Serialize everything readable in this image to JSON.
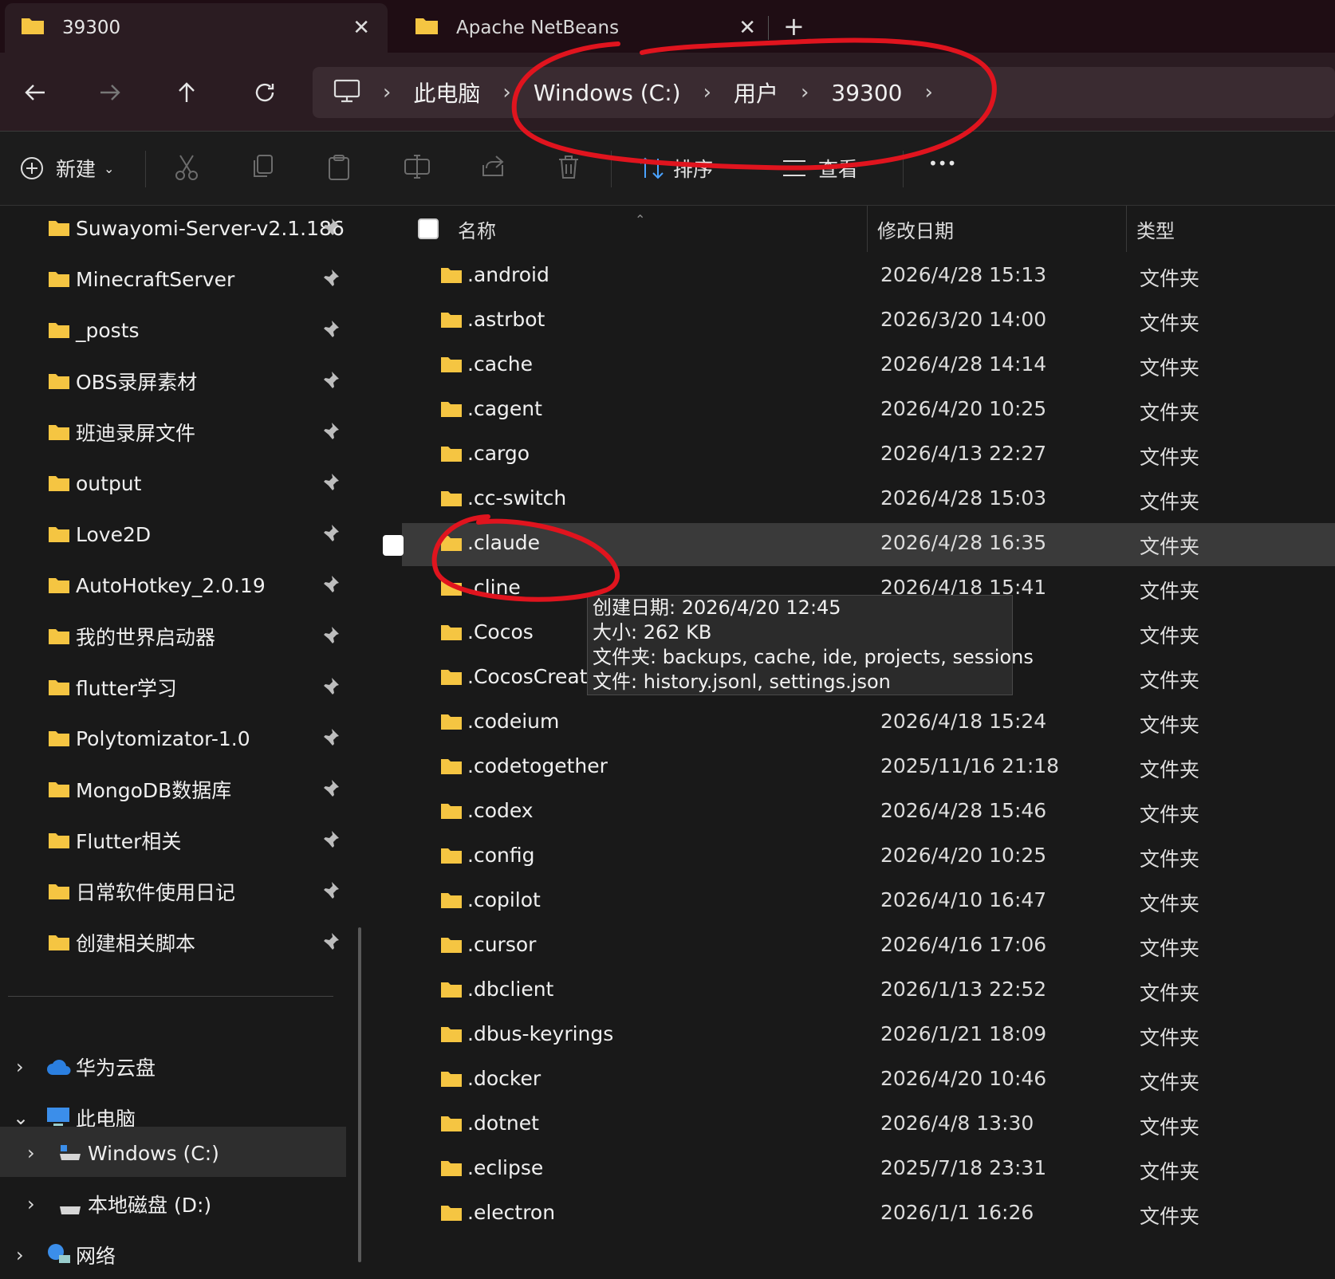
{
  "tabs": [
    {
      "label": "39300",
      "active": true
    },
    {
      "label": "Apache NetBeans",
      "active": false
    }
  ],
  "tab_close_glyph": "✕",
  "new_tab_glyph": "+",
  "breadcrumb": [
    "此电脑",
    "Windows (C:)",
    "用户",
    "39300"
  ],
  "toolbar": {
    "new_label": "新建",
    "sort_label": "排序",
    "view_label": "查看",
    "more_glyph": "•••"
  },
  "sidebar": {
    "pinned": [
      "Suwayomi-Server-v2.1.186",
      "MinecraftServer",
      "_posts",
      "OBS录屏素材",
      "班迪录屏文件",
      "output",
      "Love2D",
      "AutoHotkey_2.0.19",
      "我的世界启动器",
      "flutter学习",
      "Polytomizator-1.0",
      "MongoDB数据库",
      "Flutter相关",
      "日常软件使用日记",
      "创建相关脚本"
    ],
    "tree": {
      "cloud": "华为云盘",
      "this_pc": "此电脑",
      "drive_c": "Windows (C:)",
      "drive_d": "本地磁盘 (D:)",
      "network": "网络"
    }
  },
  "columns": {
    "name": "名称",
    "date": "修改日期",
    "type": "类型"
  },
  "files": [
    {
      "name": ".android",
      "date": "2026/4/28 15:13",
      "type": "文件夹"
    },
    {
      "name": ".astrbot",
      "date": "2026/3/20 14:00",
      "type": "文件夹"
    },
    {
      "name": ".cache",
      "date": "2026/4/28 14:14",
      "type": "文件夹"
    },
    {
      "name": ".cagent",
      "date": "2026/4/20 10:25",
      "type": "文件夹"
    },
    {
      "name": ".cargo",
      "date": "2026/4/13 22:27",
      "type": "文件夹"
    },
    {
      "name": ".cc-switch",
      "date": "2026/4/28 15:03",
      "type": "文件夹"
    },
    {
      "name": ".claude",
      "date": "2026/4/28 16:35",
      "type": "文件夹"
    },
    {
      "name": ".cline",
      "date": "2026/4/18 15:41",
      "type": "文件夹"
    },
    {
      "name": ".Cocos",
      "date": "",
      "type": "文件夹"
    },
    {
      "name": ".CocosCreato",
      "date": "",
      "type": "文件夹"
    },
    {
      "name": ".codeium",
      "date": "2026/4/18 15:24",
      "type": "文件夹"
    },
    {
      "name": ".codetogether",
      "date": "2025/11/16 21:18",
      "type": "文件夹"
    },
    {
      "name": ".codex",
      "date": "2026/4/28 15:46",
      "type": "文件夹"
    },
    {
      "name": ".config",
      "date": "2026/4/20 10:25",
      "type": "文件夹"
    },
    {
      "name": ".copilot",
      "date": "2026/4/10 16:47",
      "type": "文件夹"
    },
    {
      "name": ".cursor",
      "date": "2026/4/16 17:06",
      "type": "文件夹"
    },
    {
      "name": ".dbclient",
      "date": "2026/1/13 22:52",
      "type": "文件夹"
    },
    {
      "name": ".dbus-keyrings",
      "date": "2026/1/21 18:09",
      "type": "文件夹"
    },
    {
      "name": ".docker",
      "date": "2026/4/20 10:46",
      "type": "文件夹"
    },
    {
      "name": ".dotnet",
      "date": "2026/4/8 13:30",
      "type": "文件夹"
    },
    {
      "name": ".eclipse",
      "date": "2025/7/18 23:31",
      "type": "文件夹"
    },
    {
      "name": ".electron",
      "date": "2026/1/1 16:26",
      "type": "文件夹"
    }
  ],
  "hovered_index": 6,
  "tooltip": {
    "line1": "创建日期: 2026/4/20 12:45",
    "line2": "大小: 262 KB",
    "line3": "文件夹: backups, cache, ide, projects, sessions",
    "line4": "文件: history.jsonl, settings.json"
  },
  "colors": {
    "folder": "#f5c542",
    "annotation": "#e0141e",
    "cloud": "#2b7fe0",
    "monitor": "#3b8eea"
  },
  "icons": {
    "back": "arrow-left-icon",
    "forward": "arrow-right-icon",
    "up": "arrow-up-icon",
    "refresh": "refresh-icon",
    "computer": "computer-icon",
    "cut": "scissors-icon",
    "copy": "copy-icon",
    "paste": "clipboard-icon",
    "rename": "rename-icon",
    "share": "share-icon",
    "delete": "trash-icon",
    "pin": "pin-icon"
  }
}
